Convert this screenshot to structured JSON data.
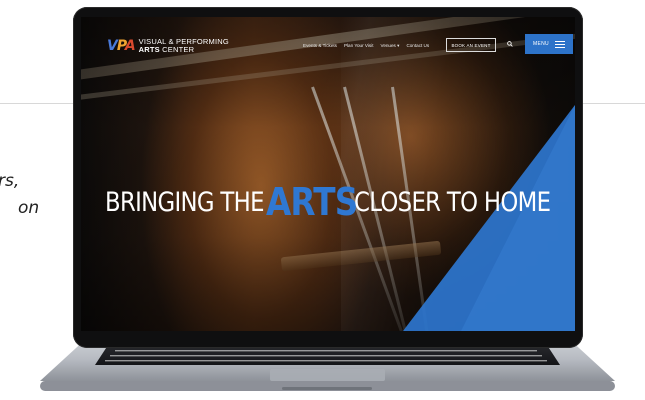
{
  "side_text": {
    "line1": "rs,",
    "line2": "on",
    "line3": ""
  },
  "website": {
    "logo": {
      "mark": {
        "v": "V",
        "p": "P",
        "a": "A"
      },
      "line1": "VISUAL & PERFORMING",
      "line2_bold": "ARTS",
      "line2_rest": " CENTER"
    },
    "nav": {
      "items": [
        "Events & Tickets",
        "Plan Your Visit",
        "Venues ▾",
        "Contact Us"
      ],
      "book_button": "BOOK AN EVENT",
      "search_icon": "search-icon",
      "menu_label": "MENU",
      "menu_icon": "hamburger-icon"
    },
    "hero": {
      "headline_part1": "BRINGING THE",
      "headline_accent": "ARTS",
      "headline_part2": "CLOSER TO HOME"
    }
  },
  "colors": {
    "accent_blue": "#2f78d2",
    "menu_blue": "#2d73c9",
    "logo_orange": "#f2a531",
    "logo_red": "#d84a2e"
  }
}
